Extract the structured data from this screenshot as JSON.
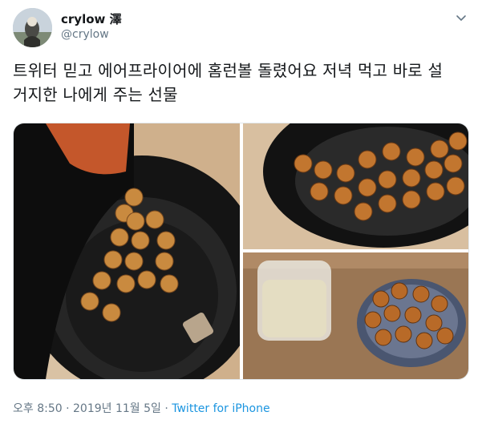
{
  "user": {
    "display_name": "crylow 澤",
    "handle": "@crylow"
  },
  "tweet": {
    "text_line1": "트위터 믿고 에어프라이어에 홈런볼 돌렸어요 저녁 먹고 바로 설",
    "text_line2": "거지한 나에게 주는 선물"
  },
  "footer": {
    "timestamp": "오후 8:50 · 2019년 11월 5일",
    "separator": " · ",
    "source": "Twitter for iPhone"
  },
  "icons": {
    "more": "chevron-down-icon"
  },
  "colors": {
    "text": "#14171a",
    "secondary": "#657786",
    "link": "#1b95e0"
  }
}
